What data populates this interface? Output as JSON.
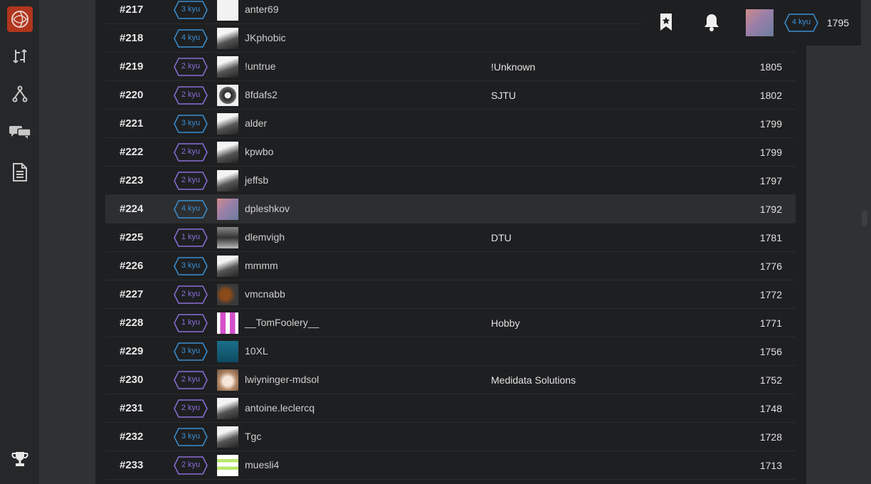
{
  "sidebar": {
    "icons": [
      "codewars-logo",
      "kata-icon",
      "fork-icon",
      "chat-icon",
      "docs-icon",
      "trophy-icon"
    ]
  },
  "topbar": {
    "kyu": "4 kyu",
    "honor": "1795"
  },
  "leaderboard": {
    "rows": [
      {
        "rank": "#217",
        "kyu": "3 kyu",
        "kyu_level": 3,
        "user": "anter69",
        "clan": "",
        "honor": ""
      },
      {
        "rank": "#218",
        "kyu": "4 kyu",
        "kyu_level": 4,
        "user": "JKphobic",
        "clan": "",
        "honor": ""
      },
      {
        "rank": "#219",
        "kyu": "2 kyu",
        "kyu_level": 2,
        "user": "!untrue",
        "clan": "!Unknown",
        "honor": "1805"
      },
      {
        "rank": "#220",
        "kyu": "2 kyu",
        "kyu_level": 2,
        "user": "8fdafs2",
        "clan": "SJTU",
        "honor": "1802"
      },
      {
        "rank": "#221",
        "kyu": "3 kyu",
        "kyu_level": 3,
        "user": "alder",
        "clan": "",
        "honor": "1799"
      },
      {
        "rank": "#222",
        "kyu": "2 kyu",
        "kyu_level": 2,
        "user": "kpwbo",
        "clan": "",
        "honor": "1799"
      },
      {
        "rank": "#223",
        "kyu": "2 kyu",
        "kyu_level": 2,
        "user": "jeffsb",
        "clan": "",
        "honor": "1797"
      },
      {
        "rank": "#224",
        "kyu": "4 kyu",
        "kyu_level": 4,
        "user": "dpleshkov",
        "clan": "",
        "honor": "1792"
      },
      {
        "rank": "#225",
        "kyu": "1 kyu",
        "kyu_level": 1,
        "user": "dlemvigh",
        "clan": "DTU",
        "honor": "1781"
      },
      {
        "rank": "#226",
        "kyu": "3 kyu",
        "kyu_level": 3,
        "user": "mmmm",
        "clan": "",
        "honor": "1776"
      },
      {
        "rank": "#227",
        "kyu": "2 kyu",
        "kyu_level": 2,
        "user": "vmcnabb",
        "clan": "",
        "honor": "1772"
      },
      {
        "rank": "#228",
        "kyu": "1 kyu",
        "kyu_level": 1,
        "user": "__TomFoolery__",
        "clan": "Hobby",
        "honor": "1771"
      },
      {
        "rank": "#229",
        "kyu": "3 kyu",
        "kyu_level": 3,
        "user": "10XL",
        "clan": "",
        "honor": "1756"
      },
      {
        "rank": "#230",
        "kyu": "2 kyu",
        "kyu_level": 2,
        "user": "lwiyninger-mdsol",
        "clan": "Medidata Solutions",
        "honor": "1752"
      },
      {
        "rank": "#231",
        "kyu": "2 kyu",
        "kyu_level": 2,
        "user": "antoine.leclercq",
        "clan": "",
        "honor": "1748"
      },
      {
        "rank": "#232",
        "kyu": "3 kyu",
        "kyu_level": 3,
        "user": "Tgc",
        "clan": "",
        "honor": "1728"
      },
      {
        "rank": "#233",
        "kyu": "2 kyu",
        "kyu_level": 2,
        "user": "muesli4",
        "clan": "",
        "honor": "1713"
      }
    ]
  },
  "colors": {
    "kyu_purple": "#8b6fd8",
    "kyu_blue": "#3a8fd1",
    "logo_red": "#b1361e"
  }
}
